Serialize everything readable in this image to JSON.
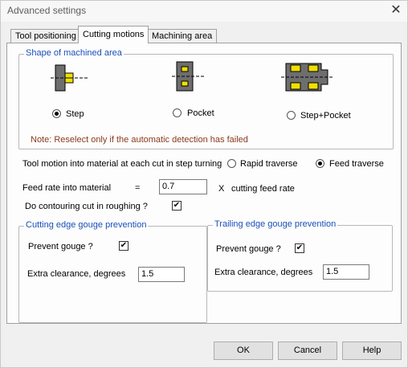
{
  "window": {
    "title": "Advanced settings",
    "close_glyph": "✕"
  },
  "tabs": [
    {
      "label": "Tool positioning",
      "active": false
    },
    {
      "label": "Cutting motions",
      "active": true
    },
    {
      "label": "Machining area",
      "active": false
    }
  ],
  "shape_group": {
    "legend": "Shape of machined area",
    "options": [
      {
        "label": "Step",
        "selected": true
      },
      {
        "label": "Pocket",
        "selected": false
      },
      {
        "label": "Step+Pocket",
        "selected": false
      }
    ],
    "note": "Note: Reselect only if the automatic detection has failed"
  },
  "tool_motion": {
    "label": "Tool motion into material at each cut in step turning",
    "options": [
      {
        "label": "Rapid traverse",
        "selected": false
      },
      {
        "label": "Feed traverse",
        "selected": true
      }
    ]
  },
  "feed_rate": {
    "label": "Feed rate into material",
    "equals": "=",
    "value": "0.7",
    "multiplier": "X",
    "unit": "cutting feed rate"
  },
  "contouring": {
    "label": "Do contouring cut in roughing ?",
    "checked": true,
    "check_glyph": "✔"
  },
  "cutting_edge_group": {
    "legend": "Cutting edge gouge prevention",
    "prevent_label": "Prevent gouge ?",
    "prevent_checked": true,
    "clearance_label": "Extra clearance, degrees",
    "clearance_value": "1.5"
  },
  "trailing_edge_group": {
    "legend": "Trailing edge gouge prevention",
    "prevent_label": "Prevent gouge ?",
    "prevent_checked": true,
    "clearance_label": "Extra clearance, degrees",
    "clearance_value": "1.5"
  },
  "buttons": {
    "ok": "OK",
    "cancel": "Cancel",
    "help": "Help"
  },
  "colors": {
    "legend": "#1a50b8",
    "shape_yellow": "#f0e000",
    "shape_gray": "#6e6e6e"
  }
}
